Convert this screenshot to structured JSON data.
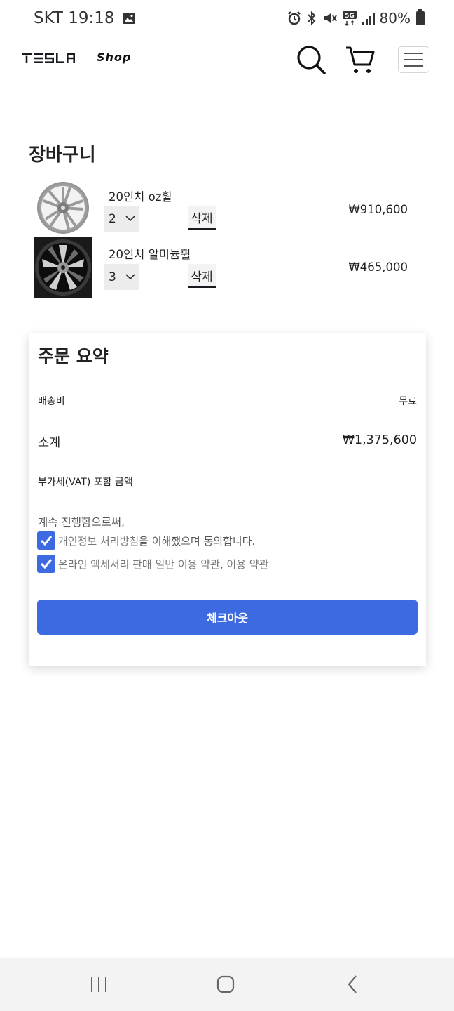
{
  "status_bar": {
    "carrier_time": "SKT 19:18",
    "battery": "80%"
  },
  "header": {
    "logo": "TESLA",
    "shop": "Shop"
  },
  "cart": {
    "title": "장바구니",
    "items": [
      {
        "name": "20인치 oz휠",
        "qty": "2",
        "delete_label": "삭제",
        "price": "₩910,600"
      },
      {
        "name": "20인치 알미늄휠",
        "qty": "3",
        "delete_label": "삭제",
        "price": "₩465,000"
      }
    ]
  },
  "summary": {
    "title": "주문 요약",
    "shipping_label": "배송비",
    "shipping_value": "무료",
    "subtotal_label": "소계",
    "subtotal_value": "₩1,375,600",
    "vat_label": "부가세(VAT) 포함 금액",
    "continue_text": "계속 진행함으로써,",
    "agree1_link": "개인정보 처리방침",
    "agree1_rest": "을 이해했으며 동의합니다.",
    "agree2_link1": "온라인 액세서리 판매 일반 이용 약관",
    "agree2_sep": ", ",
    "agree2_link2": "이용 약관",
    "checkout_label": "체크아웃"
  },
  "colors": {
    "accent": "#3e6ae1",
    "text": "#171a20"
  },
  "icons": [
    "image-icon",
    "alarm-icon",
    "bluetooth-icon",
    "mute-icon",
    "5g-icon",
    "signal-icon",
    "battery-icon",
    "search-icon",
    "cart-icon",
    "menu-icon",
    "chevron-down-icon",
    "checkbox-checked-icon",
    "recent-apps-icon",
    "home-icon",
    "back-icon"
  ]
}
